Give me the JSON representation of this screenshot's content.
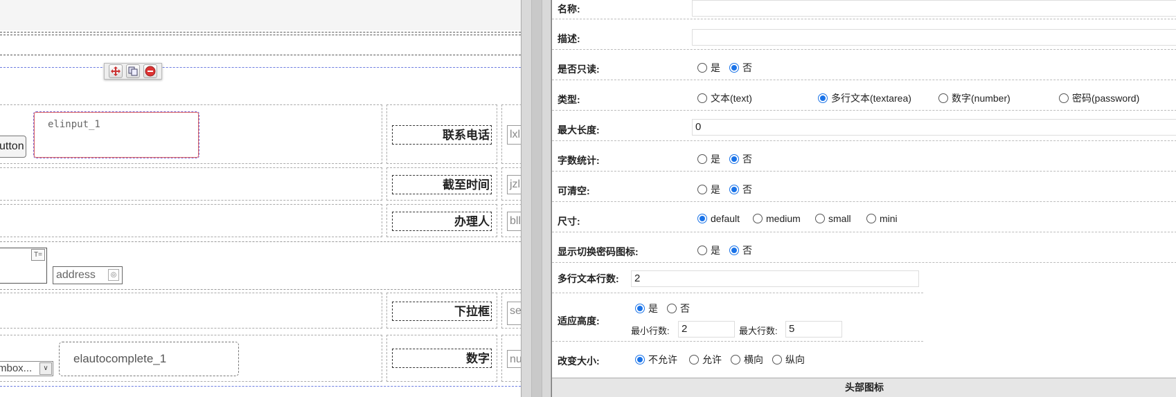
{
  "canvas": {
    "labels": [
      "联系电话",
      "截至时间",
      "办理人",
      "下拉框",
      "数字"
    ],
    "truncated_inputs": [
      "lxl",
      "jzl",
      "bll",
      "se",
      "nu"
    ],
    "elinput_placeholder": "elinput_1",
    "button_fragment": "utton",
    "address_placeholder": "address",
    "combobox_fragment": "mbox...",
    "autocomplete_placeholder": "elautocomplete_1"
  },
  "properties": {
    "name_label": "名称:",
    "name_value": "",
    "desc_label": "描述:",
    "desc_value": "",
    "readonly_label": "是否只读:",
    "type_label": "类型:",
    "type_options": [
      "文本(text)",
      "多行文本(textarea)",
      "数字(number)",
      "密码(password)"
    ],
    "maxlen_label": "最大长度:",
    "maxlen_value": "0",
    "wordcount_label": "字数统计:",
    "clearable_label": "可清空:",
    "size_label": "尺寸:",
    "size_options": [
      "default",
      "medium",
      "small",
      "mini"
    ],
    "pwdicon_label": "显示切换密码图标:",
    "rows_label": "多行文本行数:",
    "rows_value": "2",
    "autosize_label": "适应高度:",
    "minrows_label": "最小行数:",
    "minrows_value": "2",
    "maxrows_label": "最大行数:",
    "maxrows_value": "5",
    "resize_label": "改变大小:",
    "resize_options": [
      "不允许",
      "允许",
      "横向",
      "纵向"
    ],
    "yes": "是",
    "no": "否",
    "footer_title": "头部图标"
  }
}
